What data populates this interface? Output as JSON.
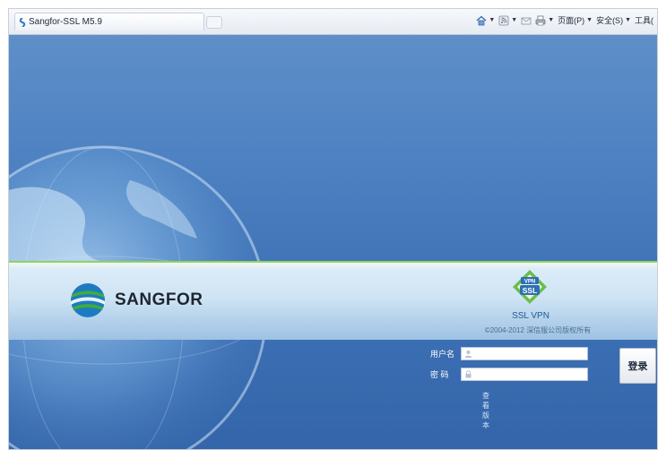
{
  "browser": {
    "tab_title": "Sangfor-SSL M5.9",
    "menu": [
      {
        "label": "页面(P)",
        "icon": "page-icon"
      },
      {
        "label": "安全(S)",
        "icon": "safety-icon"
      },
      {
        "label": "工具(",
        "icon": "tools-icon"
      }
    ],
    "toolbar_icons": [
      "home-icon",
      "feeds-icon",
      "mail-icon",
      "print-icon"
    ]
  },
  "brand": {
    "name": "SANGFOR",
    "badge_text_top": "VPN",
    "badge_text_main": "SSL",
    "product": "SSL VPN",
    "copyright": "©2004-2012 深信服公司版权所有"
  },
  "login": {
    "username_label": "用户名",
    "password_label": "密  码",
    "username_value": "",
    "password_value": "",
    "submit_label": "登录",
    "view_version_label": "查看版本"
  },
  "colors": {
    "background_blue": "#4b7fc0",
    "accent_green": "#8fd06a"
  }
}
